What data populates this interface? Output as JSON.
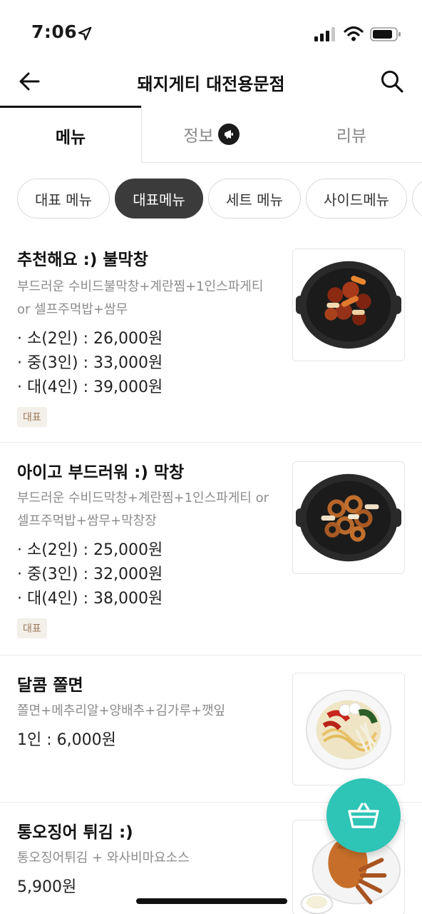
{
  "status_bar": {
    "time": "7:06"
  },
  "header": {
    "title": "돼지게티 대전용문점"
  },
  "tabs": [
    {
      "label": "메뉴",
      "active": true
    },
    {
      "label": "정보"
    },
    {
      "label": "리뷰"
    }
  ],
  "chips": [
    {
      "label": "대표 메뉴"
    },
    {
      "label": "대표메뉴",
      "selected": true
    },
    {
      "label": "세트 메뉴"
    },
    {
      "label": "사이드메뉴"
    }
  ],
  "menu_items": [
    {
      "title": "추천해요 :) 불막창",
      "desc": "부드러운 수비드불막창+계란찜+1인스파게티 or 셀프주먹밥+쌈무",
      "prices": [
        "· 소(2인) : 26,000원",
        "· 중(3인) : 33,000원",
        "· 대(4인) : 39,000원"
      ],
      "badge": "대표"
    },
    {
      "title": "아이고 부드러워 :) 막창",
      "desc": "부드러운 수비드막창+계란찜+1인스파게티 or 셀프주먹밥+쌈무+막창장",
      "prices": [
        "· 소(2인) : 25,000원",
        "· 중(3인) : 32,000원",
        "· 대(4인) : 38,000원"
      ],
      "badge": "대표"
    },
    {
      "title": "달콤 쫄면",
      "desc": "쫄면+메추리알+양배추+김가루+깻잎",
      "prices": [
        "1인 : 6,000원"
      ]
    },
    {
      "title": "통오징어 튀김 :)",
      "desc": "통오징어튀김 + 와사비마요소스",
      "prices": [
        "5,900원"
      ]
    }
  ],
  "colors": {
    "accent": "#2ec4b6",
    "badge_bg": "#f3efe9",
    "badge_text": "#9c7b5a",
    "chip_selected": "#3b3b3b"
  },
  "icons": [
    "location-arrow-icon",
    "signal-icon",
    "wifi-icon",
    "battery-icon",
    "back-arrow-icon",
    "search-icon",
    "megaphone-icon",
    "basket-icon"
  ]
}
